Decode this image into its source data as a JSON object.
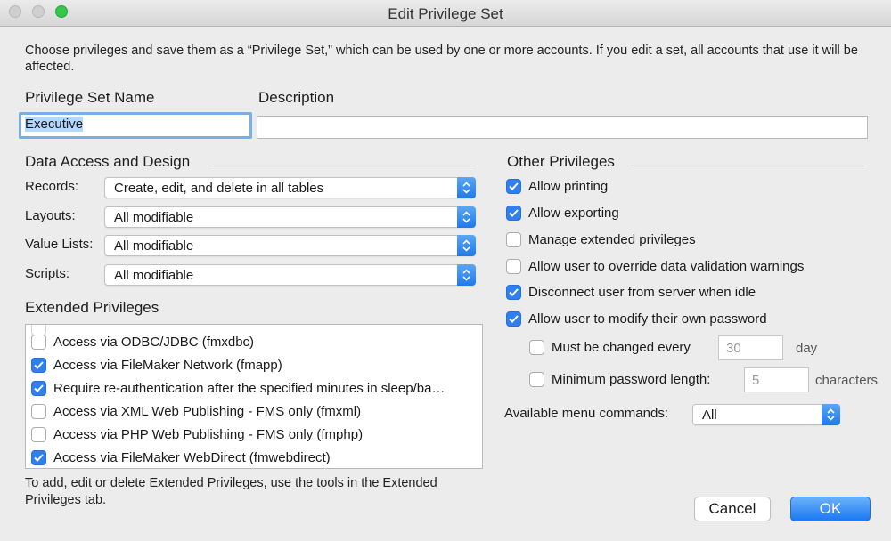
{
  "window": {
    "title": "Edit Privilege Set"
  },
  "intro": "Choose privileges and save them as a “Privilege Set,” which can be used by one or more accounts. If you edit a set, all accounts that use it will be affected.",
  "name_field": {
    "label": "Privilege Set Name",
    "value": "Executive"
  },
  "description_field": {
    "label": "Description",
    "value": ""
  },
  "data_access": {
    "title": "Data Access and Design",
    "rows": [
      {
        "label": "Records:",
        "value": "Create, edit, and delete in all tables"
      },
      {
        "label": "Layouts:",
        "value": "All modifiable"
      },
      {
        "label": "Value Lists:",
        "value": "All modifiable"
      },
      {
        "label": "Scripts:",
        "value": "All modifiable"
      }
    ]
  },
  "extended": {
    "title": "Extended Privileges",
    "items": [
      {
        "label": "Access via ODBC/JDBC (fmxdbc)",
        "checked": false
      },
      {
        "label": "Access via FileMaker Network (fmapp)",
        "checked": true
      },
      {
        "label": "Require re-authentication after the specified minutes in sleep/ba…",
        "checked": true
      },
      {
        "label": "Access via XML Web Publishing - FMS only (fmxml)",
        "checked": false
      },
      {
        "label": "Access via PHP Web Publishing - FMS only (fmphp)",
        "checked": false
      },
      {
        "label": "Access via FileMaker WebDirect (fmwebdirect)",
        "checked": true
      }
    ],
    "footnote": "To add, edit or delete Extended Privileges, use the tools in the Extended Privileges tab."
  },
  "other": {
    "title": "Other Privileges",
    "items": [
      {
        "label": "Allow printing",
        "checked": true
      },
      {
        "label": "Allow exporting",
        "checked": true
      },
      {
        "label": "Manage extended privileges",
        "checked": false
      },
      {
        "label": "Allow user to override data validation warnings",
        "checked": false
      },
      {
        "label": "Disconnect user from server when idle",
        "checked": true
      },
      {
        "label": "Allow user to modify their own password",
        "checked": true
      }
    ],
    "password_change": {
      "label": "Must be changed every",
      "checked": false,
      "value": "30",
      "unit": "day"
    },
    "password_length": {
      "label": "Minimum password length:",
      "checked": false,
      "value": "5",
      "unit": "characters"
    },
    "menu_commands": {
      "label": "Available menu commands:",
      "value": "All"
    }
  },
  "buttons": {
    "cancel": "Cancel",
    "ok": "OK"
  },
  "colors": {
    "accent": "#2f7ff0",
    "focus_ring": "#7aaee8",
    "window_bg": "#ececec"
  }
}
